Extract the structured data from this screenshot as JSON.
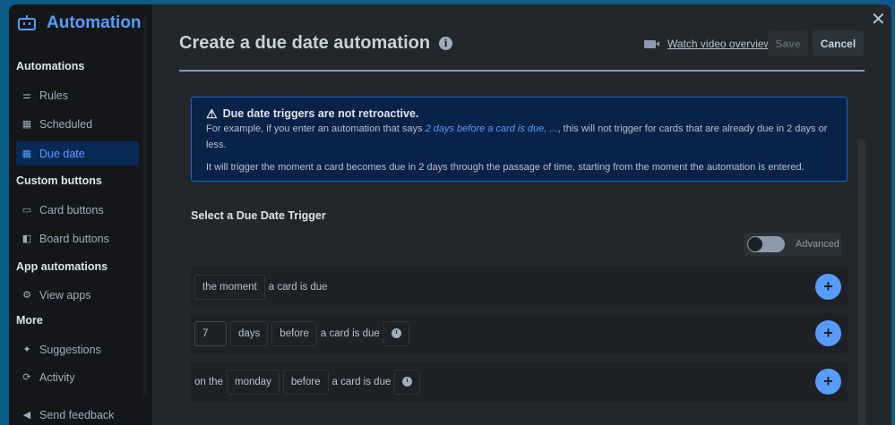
{
  "sidebar": {
    "brand": "Automation",
    "sections": [
      {
        "title": "Automations",
        "items": [
          {
            "label": "Rules",
            "icon": "sliders-icon"
          },
          {
            "label": "Scheduled",
            "icon": "calendar-icon"
          },
          {
            "label": "Due date",
            "icon": "calendar-icon",
            "active": true
          }
        ]
      },
      {
        "title": "Custom buttons",
        "items": [
          {
            "label": "Card buttons",
            "icon": "card-icon"
          },
          {
            "label": "Board buttons",
            "icon": "board-icon"
          }
        ]
      },
      {
        "title": "App automations",
        "items": [
          {
            "label": "View apps",
            "icon": "gear-icon"
          }
        ]
      },
      {
        "title": "More",
        "items": [
          {
            "label": "Suggestions",
            "icon": "sparkle-icon"
          },
          {
            "label": "Activity",
            "icon": "refresh-icon"
          },
          {
            "label": "Send feedback",
            "icon": "megaphone-icon"
          }
        ]
      }
    ]
  },
  "header": {
    "title": "Create a due date automation",
    "video_link": "Watch video overview",
    "save": "Save",
    "cancel": "Cancel",
    "close": "✕"
  },
  "info": {
    "title": "Due date triggers are not retroactive.",
    "p1_pre": "For example, if you enter an automation that says ",
    "p1_em": "2 days before a card is due, ...",
    "p1_post": ", this will not trigger for cards that are already due in 2 days or less.",
    "p2": "It will trigger the moment a card becomes due in 2 days through the passage of time, starting from the moment the automation is entered."
  },
  "trigger": {
    "heading": "Select a Due Date Trigger",
    "advanced_label": "Advanced",
    "advanced_on": false,
    "rows": [
      {
        "chip1": "the moment",
        "text": "a card is due"
      },
      {
        "value": "7",
        "unit": "days",
        "relation": "before",
        "text": "a card is due"
      },
      {
        "prefix": "on the",
        "day": "monday",
        "relation": "before",
        "text": "a card is due"
      }
    ]
  }
}
